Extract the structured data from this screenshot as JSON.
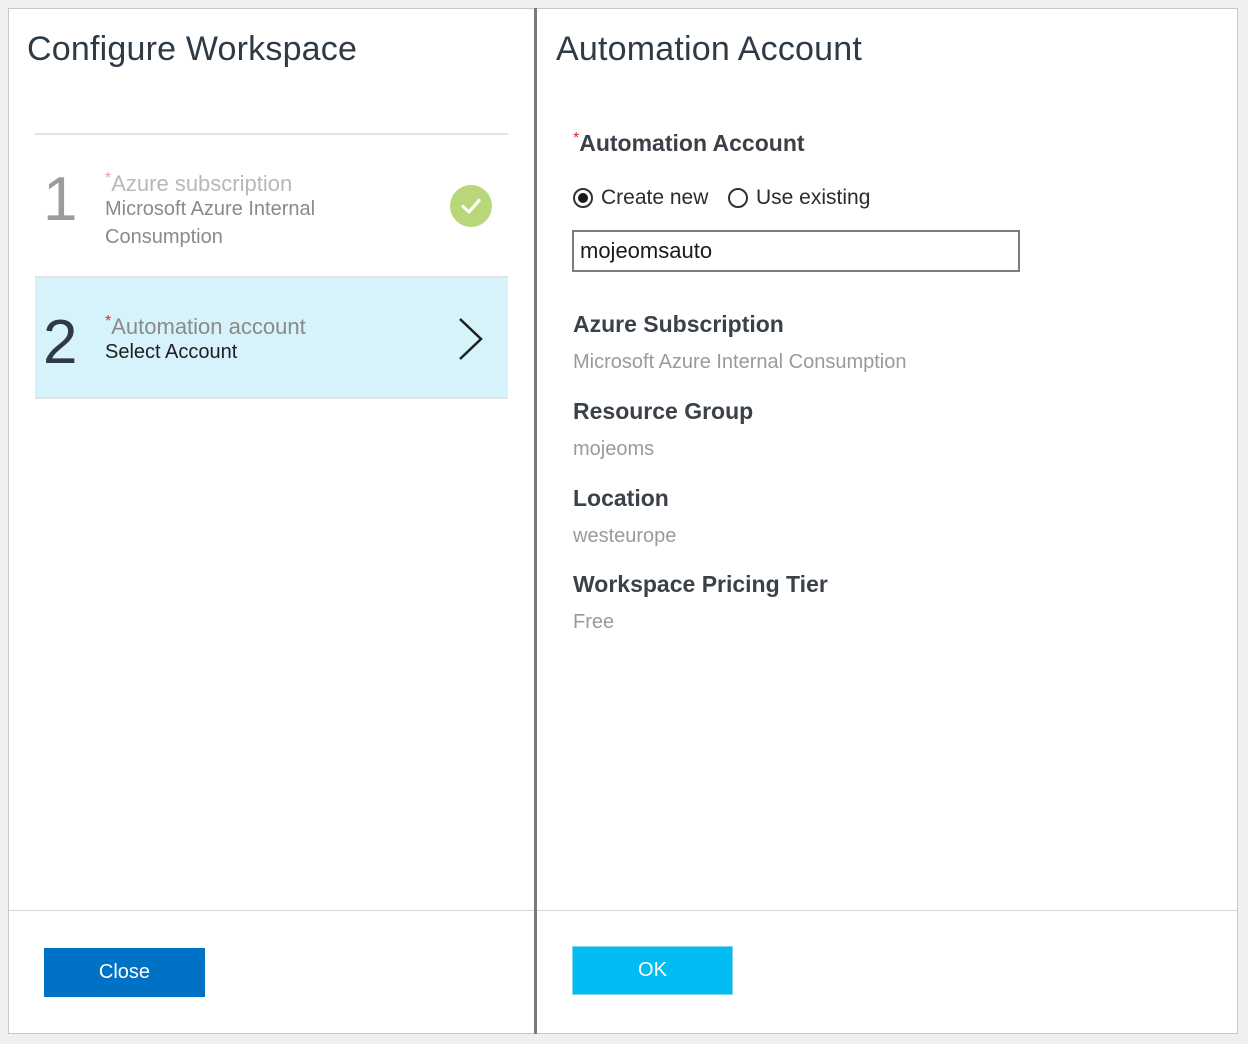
{
  "left_blade": {
    "title": "Configure Workspace",
    "steps": [
      {
        "number": "1",
        "required_mark": "*",
        "label": "Azure subscription",
        "value": "Microsoft Azure Internal Consumption",
        "status_icon": "checkmark-circle-icon",
        "status": "completed"
      },
      {
        "number": "2",
        "required_mark": "*",
        "label": "Automation account",
        "value": "Select Account",
        "status_icon": "chevron-right-icon",
        "status": "selected"
      }
    ],
    "close_label": "Close"
  },
  "right_blade": {
    "title": "Automation Account",
    "account_field": {
      "required_mark": "*",
      "label": "Automation Account",
      "options": [
        {
          "label": "Create new",
          "selected": true
        },
        {
          "label": "Use existing",
          "selected": false
        }
      ],
      "value": "mojeomsauto"
    },
    "info": [
      {
        "label": "Azure Subscription",
        "value": "Microsoft Azure Internal Consumption"
      },
      {
        "label": "Resource Group",
        "value": "mojeoms"
      },
      {
        "label": "Location",
        "value": "westeurope"
      },
      {
        "label": "Workspace Pricing Tier",
        "value": "Free"
      }
    ],
    "ok_label": "OK"
  },
  "colors": {
    "selected_step_bg": "#d6f2fb",
    "close_button": "#0072c6",
    "ok_button": "#00bcf2",
    "check_green": "#b7d77a",
    "required_red": "#e02a2a"
  }
}
